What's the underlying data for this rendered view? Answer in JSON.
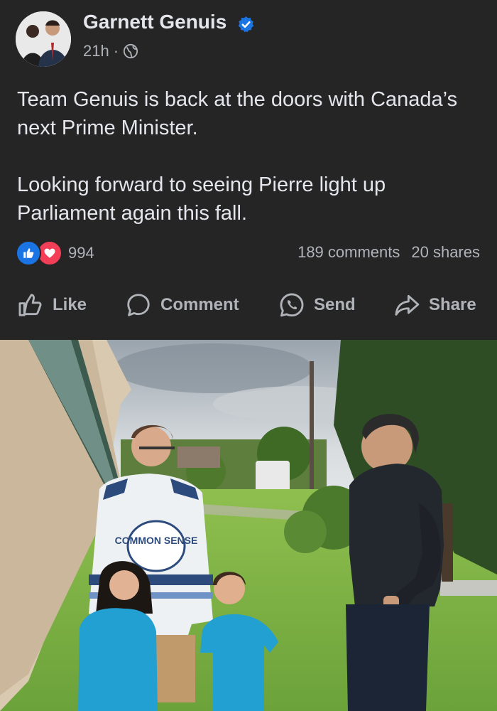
{
  "post": {
    "author": "Garnett Genuis",
    "time": "21h",
    "separator": "·",
    "text_1": "Team Genuis is back at the doors with Canada’s next Prime Minister.",
    "text_2": "Looking forward to seeing Pierre light up Parliament again this fall."
  },
  "stats": {
    "reaction_count": "994",
    "comments": "189 comments",
    "shares": "20 shares"
  },
  "actions": {
    "like": "Like",
    "comment": "Comment",
    "send": "Send",
    "share": "Share"
  },
  "photo": {
    "jersey_text": "COMMON SENSE"
  },
  "colors": {
    "background": "#252526",
    "text": "#e4e6eb",
    "secondary": "#b0b3b8",
    "like_blue": "#1b74e4",
    "love_red": "#f33e58"
  }
}
